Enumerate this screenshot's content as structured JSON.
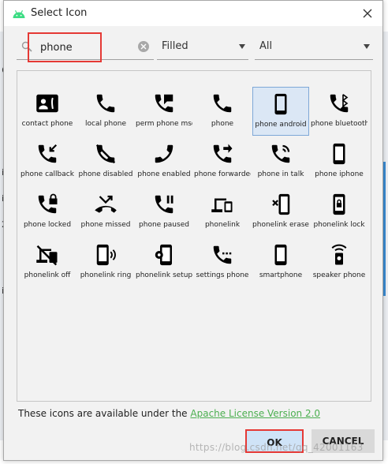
{
  "window": {
    "title": "Select Icon"
  },
  "background": {
    "fragments": [
      "c",
      "ic",
      "i",
      "24",
      "it"
    ]
  },
  "search": {
    "value": "phone",
    "placeholder": ""
  },
  "filters": {
    "style": "Filled",
    "category": "All"
  },
  "icons": [
    {
      "label": "contact phone",
      "icon": "contact-phone-icon"
    },
    {
      "label": "local phone",
      "icon": "local-phone-icon"
    },
    {
      "label": "perm phone msg",
      "icon": "perm-phone-msg-icon"
    },
    {
      "label": "phone",
      "icon": "phone-icon"
    },
    {
      "label": "phone android",
      "icon": "phone-android-icon",
      "selected": true
    },
    {
      "label": "phone bluetooth",
      "icon": "phone-bluetooth-icon"
    },
    {
      "label": "phone callback",
      "icon": "phone-callback-icon"
    },
    {
      "label": "phone disabled",
      "icon": "phone-disabled-icon"
    },
    {
      "label": "phone enabled",
      "icon": "phone-enabled-icon"
    },
    {
      "label": "phone forwarded",
      "icon": "phone-forwarded-icon"
    },
    {
      "label": "phone in talk",
      "icon": "phone-in-talk-icon"
    },
    {
      "label": "phone iphone",
      "icon": "phone-iphone-icon"
    },
    {
      "label": "phone locked",
      "icon": "phone-locked-icon"
    },
    {
      "label": "phone missed",
      "icon": "phone-missed-icon"
    },
    {
      "label": "phone paused",
      "icon": "phone-paused-icon"
    },
    {
      "label": "phonelink",
      "icon": "phonelink-icon"
    },
    {
      "label": "phonelink erase",
      "icon": "phonelink-erase-icon"
    },
    {
      "label": "phonelink lock",
      "icon": "phonelink-lock-icon"
    },
    {
      "label": "phonelink off",
      "icon": "phonelink-off-icon"
    },
    {
      "label": "phonelink ring",
      "icon": "phonelink-ring-icon"
    },
    {
      "label": "phonelink setup",
      "icon": "phonelink-setup-icon"
    },
    {
      "label": "settings phone",
      "icon": "settings-phone-icon"
    },
    {
      "label": "smartphone",
      "icon": "smartphone-icon"
    },
    {
      "label": "speaker phone",
      "icon": "speaker-phone-icon"
    }
  ],
  "license": {
    "text": "These icons are available under the ",
    "link": "Apache License Version 2.0"
  },
  "buttons": {
    "ok": "OK",
    "cancel": "CANCEL"
  },
  "watermark": "https://blog.csdn.net/qq_42001163",
  "colors": {
    "accent_green": "#4caf50",
    "highlight_red": "#e53935",
    "selection": "#dbe7f5",
    "android_green": "#3ddc84"
  }
}
